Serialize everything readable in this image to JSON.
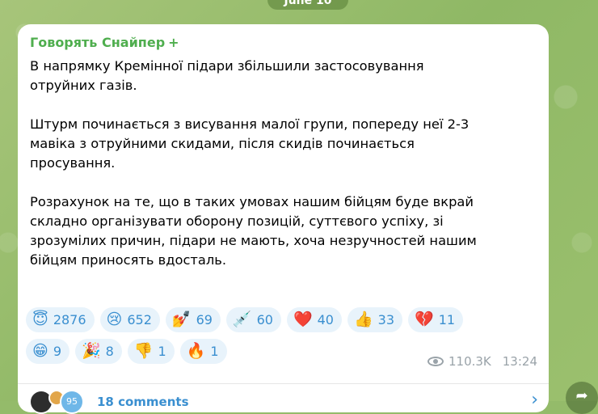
{
  "date_label": "June 10",
  "post": {
    "sender": "Говорять Снайпер",
    "sender_badge": "+",
    "paragraphs": [
      [
        "В напрямку Кремінної підари збільшили застосовування",
        "отруйних газів."
      ],
      [
        "Штурм починається з висування малої групи, попереду неї 2-3",
        "мавіка з отруйними скидами, після скидів починається",
        "просування."
      ],
      [
        "Розрахунок на те, що в таких умовах нашим бійцям буде вкрай",
        "складно організувати оборону позицій, суттєвого успіху, зі",
        "зрозумілих причин, підари не мають, хоча незручностей нашим",
        "бійцям приносять вдосталь."
      ]
    ],
    "reactions_row1": [
      {
        "emoji": "😇",
        "count": "2876"
      },
      {
        "emoji": "😢",
        "count": "652"
      },
      {
        "emoji": "💅",
        "count": "69"
      },
      {
        "emoji": "💉",
        "count": "60"
      },
      {
        "emoji": "❤️",
        "count": "40"
      },
      {
        "emoji": "👍",
        "count": "33"
      },
      {
        "emoji": "💔",
        "count": "11"
      }
    ],
    "reactions_row2": [
      {
        "emoji": "😁",
        "count": "9"
      },
      {
        "emoji": "🎉",
        "count": "8"
      },
      {
        "emoji": "👎",
        "count": "1"
      },
      {
        "emoji": "🔥",
        "count": "1"
      }
    ],
    "views": "110.3K",
    "time": "13:24",
    "comments_label": "18 comments",
    "avatar_badge": "95"
  }
}
